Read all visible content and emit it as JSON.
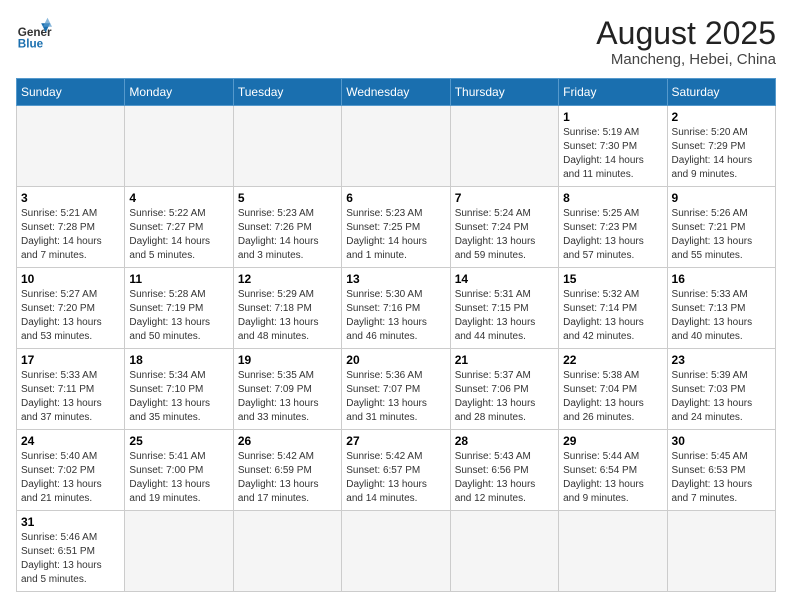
{
  "header": {
    "logo_general": "General",
    "logo_blue": "Blue",
    "title": "August 2025",
    "subtitle": "Mancheng, Hebei, China"
  },
  "days_of_week": [
    "Sunday",
    "Monday",
    "Tuesday",
    "Wednesday",
    "Thursday",
    "Friday",
    "Saturday"
  ],
  "weeks": [
    [
      {
        "day": "",
        "info": ""
      },
      {
        "day": "",
        "info": ""
      },
      {
        "day": "",
        "info": ""
      },
      {
        "day": "",
        "info": ""
      },
      {
        "day": "",
        "info": ""
      },
      {
        "day": "1",
        "info": "Sunrise: 5:19 AM\nSunset: 7:30 PM\nDaylight: 14 hours and 11 minutes."
      },
      {
        "day": "2",
        "info": "Sunrise: 5:20 AM\nSunset: 7:29 PM\nDaylight: 14 hours and 9 minutes."
      }
    ],
    [
      {
        "day": "3",
        "info": "Sunrise: 5:21 AM\nSunset: 7:28 PM\nDaylight: 14 hours and 7 minutes."
      },
      {
        "day": "4",
        "info": "Sunrise: 5:22 AM\nSunset: 7:27 PM\nDaylight: 14 hours and 5 minutes."
      },
      {
        "day": "5",
        "info": "Sunrise: 5:23 AM\nSunset: 7:26 PM\nDaylight: 14 hours and 3 minutes."
      },
      {
        "day": "6",
        "info": "Sunrise: 5:23 AM\nSunset: 7:25 PM\nDaylight: 14 hours and 1 minute."
      },
      {
        "day": "7",
        "info": "Sunrise: 5:24 AM\nSunset: 7:24 PM\nDaylight: 13 hours and 59 minutes."
      },
      {
        "day": "8",
        "info": "Sunrise: 5:25 AM\nSunset: 7:23 PM\nDaylight: 13 hours and 57 minutes."
      },
      {
        "day": "9",
        "info": "Sunrise: 5:26 AM\nSunset: 7:21 PM\nDaylight: 13 hours and 55 minutes."
      }
    ],
    [
      {
        "day": "10",
        "info": "Sunrise: 5:27 AM\nSunset: 7:20 PM\nDaylight: 13 hours and 53 minutes."
      },
      {
        "day": "11",
        "info": "Sunrise: 5:28 AM\nSunset: 7:19 PM\nDaylight: 13 hours and 50 minutes."
      },
      {
        "day": "12",
        "info": "Sunrise: 5:29 AM\nSunset: 7:18 PM\nDaylight: 13 hours and 48 minutes."
      },
      {
        "day": "13",
        "info": "Sunrise: 5:30 AM\nSunset: 7:16 PM\nDaylight: 13 hours and 46 minutes."
      },
      {
        "day": "14",
        "info": "Sunrise: 5:31 AM\nSunset: 7:15 PM\nDaylight: 13 hours and 44 minutes."
      },
      {
        "day": "15",
        "info": "Sunrise: 5:32 AM\nSunset: 7:14 PM\nDaylight: 13 hours and 42 minutes."
      },
      {
        "day": "16",
        "info": "Sunrise: 5:33 AM\nSunset: 7:13 PM\nDaylight: 13 hours and 40 minutes."
      }
    ],
    [
      {
        "day": "17",
        "info": "Sunrise: 5:33 AM\nSunset: 7:11 PM\nDaylight: 13 hours and 37 minutes."
      },
      {
        "day": "18",
        "info": "Sunrise: 5:34 AM\nSunset: 7:10 PM\nDaylight: 13 hours and 35 minutes."
      },
      {
        "day": "19",
        "info": "Sunrise: 5:35 AM\nSunset: 7:09 PM\nDaylight: 13 hours and 33 minutes."
      },
      {
        "day": "20",
        "info": "Sunrise: 5:36 AM\nSunset: 7:07 PM\nDaylight: 13 hours and 31 minutes."
      },
      {
        "day": "21",
        "info": "Sunrise: 5:37 AM\nSunset: 7:06 PM\nDaylight: 13 hours and 28 minutes."
      },
      {
        "day": "22",
        "info": "Sunrise: 5:38 AM\nSunset: 7:04 PM\nDaylight: 13 hours and 26 minutes."
      },
      {
        "day": "23",
        "info": "Sunrise: 5:39 AM\nSunset: 7:03 PM\nDaylight: 13 hours and 24 minutes."
      }
    ],
    [
      {
        "day": "24",
        "info": "Sunrise: 5:40 AM\nSunset: 7:02 PM\nDaylight: 13 hours and 21 minutes."
      },
      {
        "day": "25",
        "info": "Sunrise: 5:41 AM\nSunset: 7:00 PM\nDaylight: 13 hours and 19 minutes."
      },
      {
        "day": "26",
        "info": "Sunrise: 5:42 AM\nSunset: 6:59 PM\nDaylight: 13 hours and 17 minutes."
      },
      {
        "day": "27",
        "info": "Sunrise: 5:42 AM\nSunset: 6:57 PM\nDaylight: 13 hours and 14 minutes."
      },
      {
        "day": "28",
        "info": "Sunrise: 5:43 AM\nSunset: 6:56 PM\nDaylight: 13 hours and 12 minutes."
      },
      {
        "day": "29",
        "info": "Sunrise: 5:44 AM\nSunset: 6:54 PM\nDaylight: 13 hours and 9 minutes."
      },
      {
        "day": "30",
        "info": "Sunrise: 5:45 AM\nSunset: 6:53 PM\nDaylight: 13 hours and 7 minutes."
      }
    ],
    [
      {
        "day": "31",
        "info": "Sunrise: 5:46 AM\nSunset: 6:51 PM\nDaylight: 13 hours and 5 minutes."
      },
      {
        "day": "",
        "info": ""
      },
      {
        "day": "",
        "info": ""
      },
      {
        "day": "",
        "info": ""
      },
      {
        "day": "",
        "info": ""
      },
      {
        "day": "",
        "info": ""
      },
      {
        "day": "",
        "info": ""
      }
    ]
  ]
}
